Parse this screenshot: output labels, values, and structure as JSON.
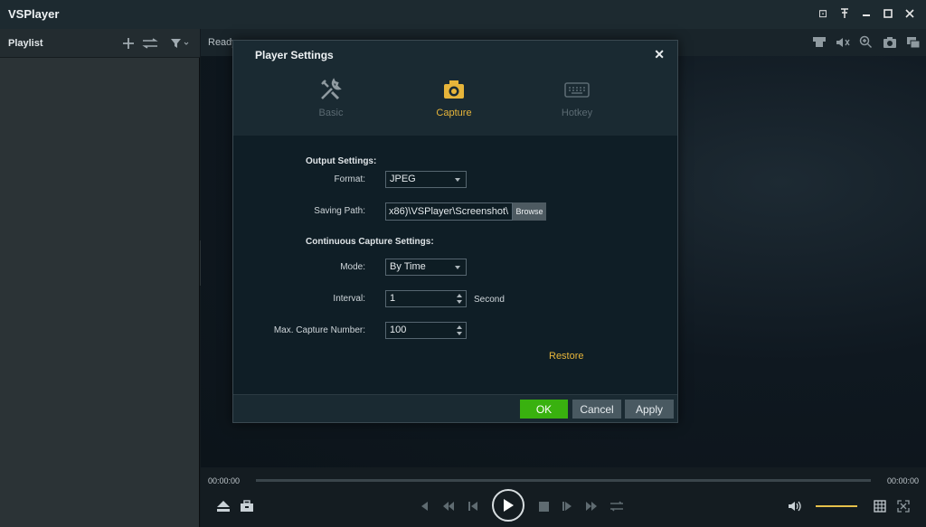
{
  "app": {
    "title": "VSPlayer"
  },
  "window_controls": [
    {
      "icon": "window-icon",
      "glyph": "⊡"
    },
    {
      "icon": "pin-icon",
      "glyph": "⊤"
    },
    {
      "icon": "minimize-icon",
      "glyph": "–"
    },
    {
      "icon": "maximize-icon",
      "glyph": "□"
    },
    {
      "icon": "close-icon",
      "glyph": "✕"
    }
  ],
  "playlist": {
    "title": "Playlist"
  },
  "video": {
    "status": "Ready"
  },
  "playback": {
    "current_time": "00:00:00",
    "total_time": "00:00:00",
    "volume_level": 1.0
  },
  "dialog": {
    "title": "Player Settings",
    "tabs": [
      {
        "label": "Basic",
        "icon": "tools-icon",
        "active": false
      },
      {
        "label": "Capture",
        "icon": "camera-icon",
        "active": true
      },
      {
        "label": "Hotkey",
        "icon": "keyboard-icon",
        "active": false
      }
    ],
    "output_settings_label": "Output Settings:",
    "format": {
      "label": "Format:",
      "value": "JPEG"
    },
    "saving_path": {
      "label": "Saving Path:",
      "value": "x86)\\VSPlayer\\Screenshot\\",
      "browse_label": "Browse"
    },
    "continuous_label": "Continuous Capture Settings:",
    "mode": {
      "label": "Mode:",
      "value": "By Time"
    },
    "interval": {
      "label": "Interval:",
      "value": "1",
      "unit": "Second"
    },
    "max_capture": {
      "label": "Max. Capture Number:",
      "value": "100"
    },
    "restore_label": "Restore",
    "ok_label": "OK",
    "cancel_label": "Cancel",
    "apply_label": "Apply"
  },
  "colors": {
    "accent": "#e7b53a",
    "ok_green": "#39b10f"
  }
}
